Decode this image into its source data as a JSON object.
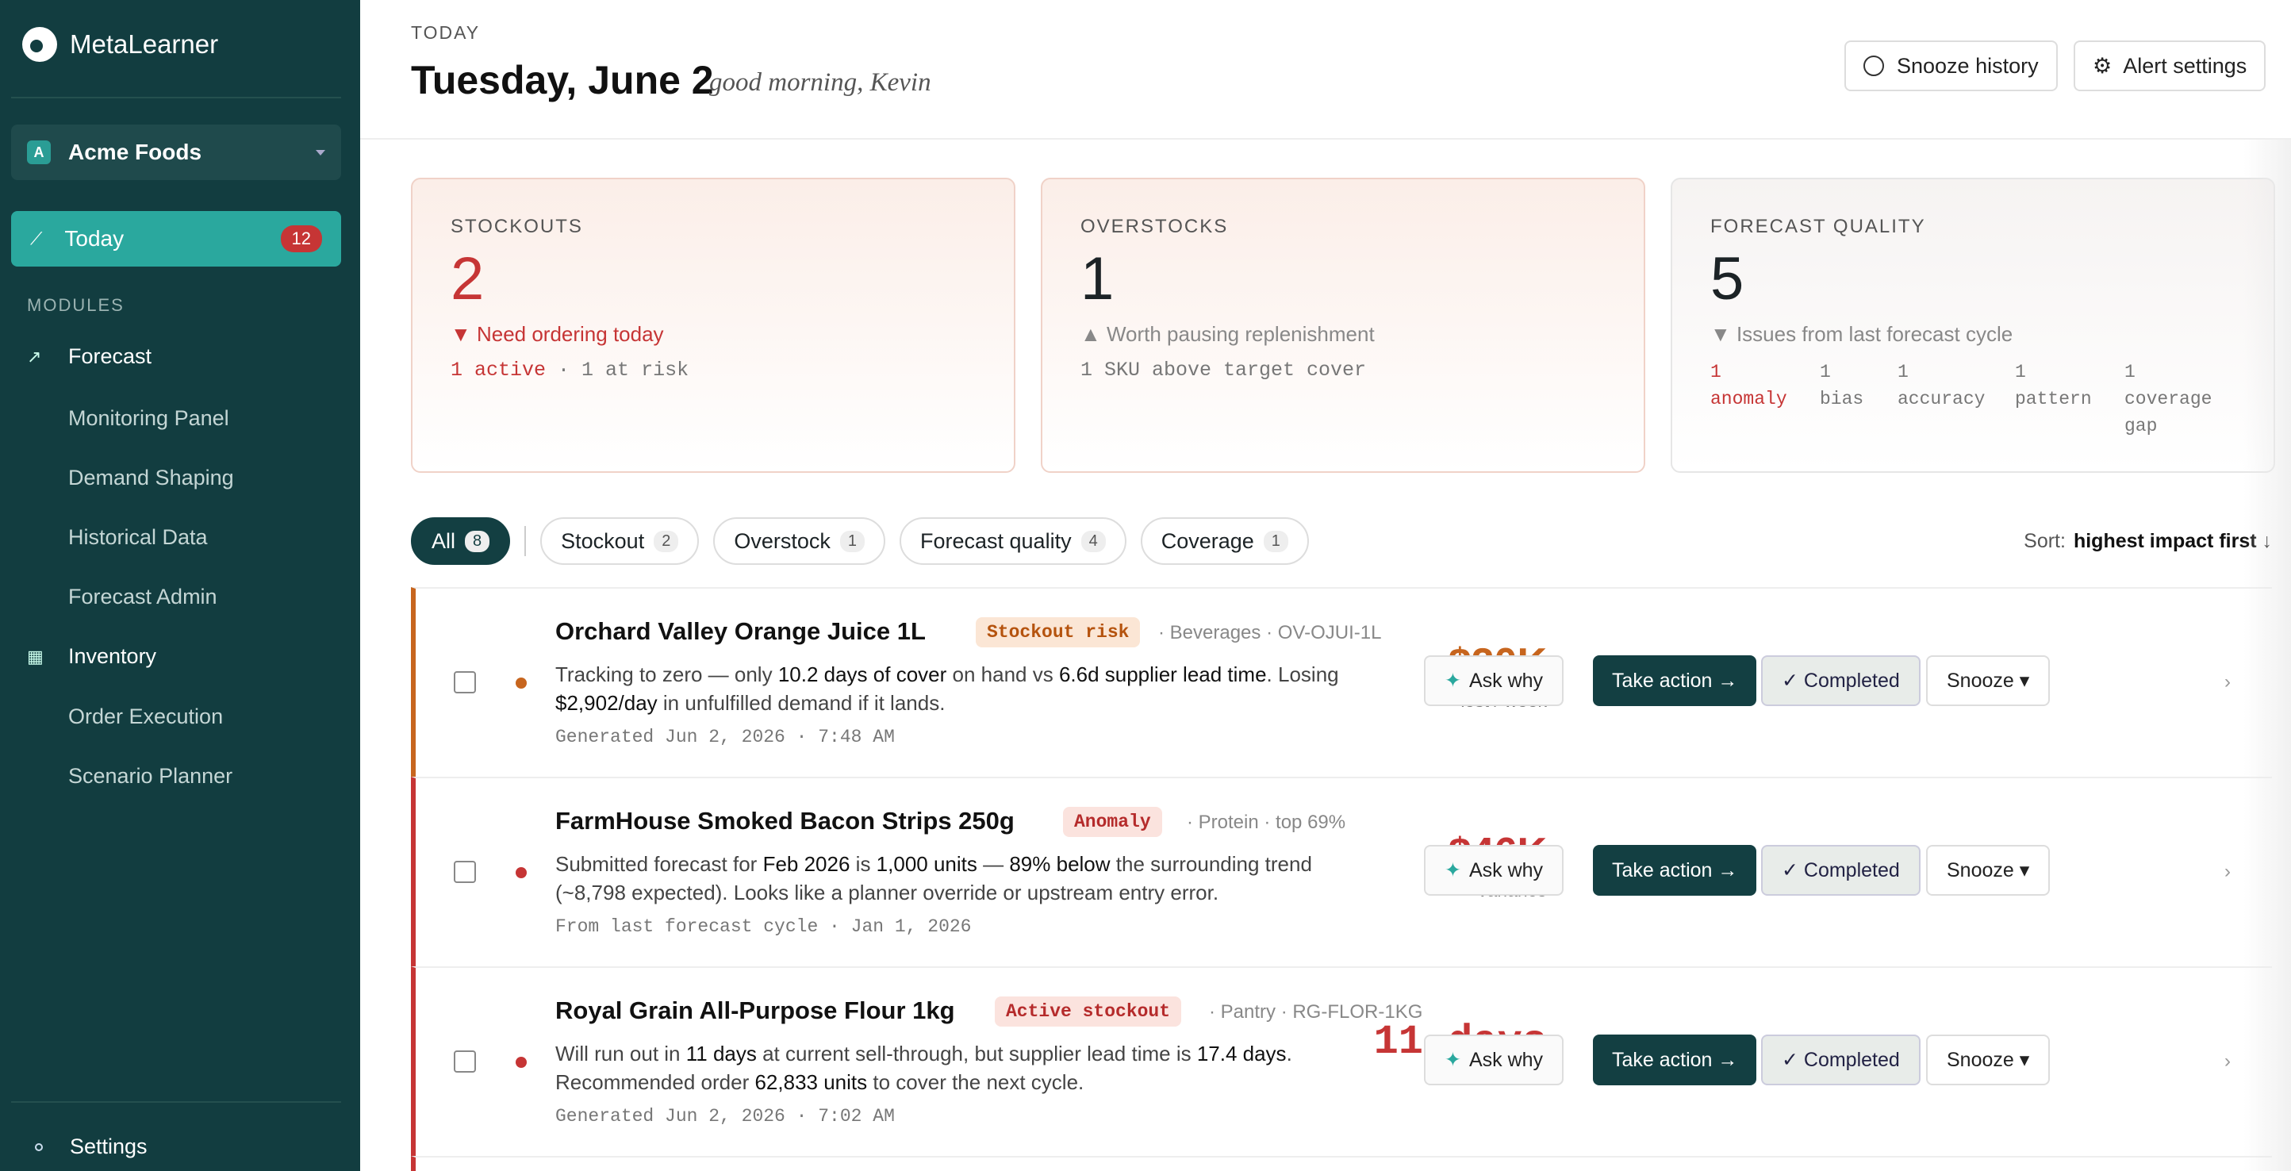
{
  "app": {
    "name": "MetaLearner"
  },
  "org": {
    "badge": "A",
    "name": "Acme Foods"
  },
  "nav": {
    "today_label": "Today",
    "today_count": "12",
    "section_label": "MODULES",
    "forecast": "Forecast",
    "forecast_items": [
      "Monitoring Panel",
      "Demand Shaping",
      "Historical Data",
      "Forecast Admin"
    ],
    "inventory": "Inventory",
    "inventory_items": [
      "Order Execution",
      "Scenario Planner"
    ],
    "settings": "Settings"
  },
  "header": {
    "eyebrow": "TODAY",
    "date": "Tuesday, June 2",
    "greeting": "good morning, Kevin",
    "snooze_history": "Snooze history",
    "alert_settings": "Alert settings"
  },
  "cards": {
    "stockouts": {
      "title": "STOCKOUTS",
      "value": "2",
      "sub": "▼ Need ordering today",
      "meta_red": "1 active",
      "meta_rest": "· 1 at risk"
    },
    "overstocks": {
      "title": "OVERSTOCKS",
      "value": "1",
      "sub": "▲ Worth pausing replenishment",
      "meta": "1 SKU above target cover"
    },
    "quality": {
      "title": "FORECAST QUALITY",
      "value": "5",
      "sub": "▼ Issues from last forecast cycle",
      "items": [
        "1 anomaly",
        "1 bias",
        "1 accuracy",
        "1 pattern",
        "1 coverage gap"
      ]
    }
  },
  "filters": [
    {
      "label": "All",
      "count": "8"
    },
    {
      "label": "Stockout",
      "count": "2"
    },
    {
      "label": "Overstock",
      "count": "1"
    },
    {
      "label": "Forecast quality",
      "count": "4"
    },
    {
      "label": "Coverage",
      "count": "1"
    }
  ],
  "sort": {
    "label": "Sort:",
    "value": "highest impact first ↓"
  },
  "actions": {
    "ask": "Ask why",
    "take": "Take action →",
    "done": "✓ Completed",
    "snooze": "Snooze ▾"
  },
  "alerts": [
    {
      "title": "Orchard Valley Orange Juice 1L",
      "tag": "Stockout risk",
      "meta": "· Beverages · OV-OJUI-1L",
      "desc_html": "Tracking to zero — only <b>10.2 days of cover</b> on hand vs <b>6.6d supplier lead time</b>. Losing <b>$2,902/day</b> in unfulfilled demand if it lands.",
      "generated": "Generated Jun 2, 2026 · 7:48 AM",
      "impact": "$20K",
      "impact_label": "lost / week",
      "accent": "#c7651e"
    },
    {
      "title": "FarmHouse Smoked Bacon Strips 250g",
      "tag": "Anomaly",
      "meta": "· Protein · top 69%",
      "desc_html": "Submitted forecast for <b>Feb 2026</b> is <b>1,000 units</b> — <b>89% below</b> the surrounding trend (~8,798 expected). Looks like a planner override or upstream entry error.",
      "generated": "From last forecast cycle · Jan 1, 2026",
      "impact": "$46K",
      "impact_label": "variance",
      "accent": "#c63535"
    },
    {
      "title": "Royal Grain All-Purpose Flour 1kg",
      "tag": "Active stockout",
      "meta": "· Pantry · RG-FLOR-1KG",
      "desc_html": "Will run out in <b>11 days</b> at current sell-through, but supplier lead time is <b>17.4 days</b>. Recommended order <b>62,833 units</b> to cover the next cycle.",
      "generated": "Generated Jun 2, 2026 · 7:02 AM",
      "impact": "11 days",
      "impact_label": "to stockout",
      "accent": "#c63535"
    }
  ]
}
